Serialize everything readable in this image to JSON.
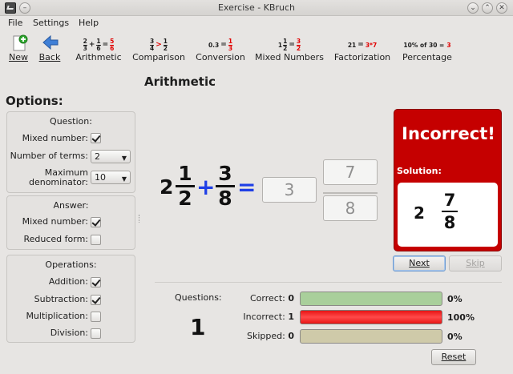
{
  "window": {
    "title": "Exercise - KBruch"
  },
  "menu": [
    "File",
    "Settings",
    "Help"
  ],
  "toolbar": {
    "new_label": "New",
    "back_label": "Back",
    "items": [
      {
        "label": "Arithmetic"
      },
      {
        "label": "Comparison"
      },
      {
        "label": "Conversion"
      },
      {
        "label": "Mixed Numbers"
      },
      {
        "label": "Factorization"
      },
      {
        "label": "Percentage"
      }
    ],
    "previews": {
      "arithmetic": {
        "a_num": "2",
        "a_den": "3",
        "op": "+",
        "b_num": "1",
        "b_den": "6",
        "eq": "=",
        "r_num": "5",
        "r_den": "6"
      },
      "comparison": {
        "a_num": "3",
        "a_den": "4",
        "op": ">",
        "b_num": "1",
        "b_den": "2"
      },
      "conversion": {
        "value": "0.3",
        "eq": "=",
        "r_num": "1",
        "r_den": "3"
      },
      "mixed": {
        "whole": "1",
        "a_num": "1",
        "a_den": "2",
        "eq": "=",
        "r_num": "3",
        "r_den": "2"
      },
      "factorization": {
        "value": "21",
        "eq": "=",
        "result": "3*7"
      },
      "percentage": {
        "text": "10% of 30 =",
        "result": "3"
      }
    }
  },
  "page_title": "Arithmetic",
  "options": {
    "heading": "Options:",
    "question": {
      "title": "Question:",
      "mixed_label": "Mixed number:",
      "mixed_checked": true,
      "terms_label": "Number of terms:",
      "terms_value": "2",
      "max_den_label_1": "Maximum",
      "max_den_label_2": "denominator:",
      "max_den_value": "10"
    },
    "answer": {
      "title": "Answer:",
      "mixed_label": "Mixed number:",
      "mixed_checked": true,
      "reduced_label": "Reduced form:",
      "reduced_checked": false
    },
    "operations": {
      "title": "Operations:",
      "items": [
        {
          "label": "Addition:",
          "checked": true
        },
        {
          "label": "Subtraction:",
          "checked": true
        },
        {
          "label": "Multiplication:",
          "checked": false
        },
        {
          "label": "Division:",
          "checked": false
        }
      ]
    }
  },
  "exercise": {
    "term1": {
      "whole": "2",
      "num": "1",
      "den": "2"
    },
    "op": "+",
    "term2": {
      "num": "3",
      "den": "8"
    },
    "eq": "=",
    "answer_whole": "3",
    "answer_num": "7",
    "answer_den": "8"
  },
  "result": {
    "title": "Incorrect!",
    "solution_label": "Solution:",
    "solution": {
      "whole": "2",
      "num": "7",
      "den": "8"
    },
    "status_color": "#c50000"
  },
  "buttons": {
    "next": "Next",
    "skip": "Skip",
    "reset": "Reset"
  },
  "stats": {
    "questions_label": "Questions:",
    "questions_count": "1",
    "rows": [
      {
        "label": "Correct:",
        "count": "0",
        "percent": "0%",
        "fraction": 0,
        "color": "#9fcc8f"
      },
      {
        "label": "Incorrect:",
        "count": "1",
        "percent": "100%",
        "fraction": 1,
        "color": "#e81515"
      },
      {
        "label": "Skipped:",
        "count": "0",
        "percent": "0%",
        "fraction": 0,
        "color": "#cbc6a0"
      }
    ]
  }
}
